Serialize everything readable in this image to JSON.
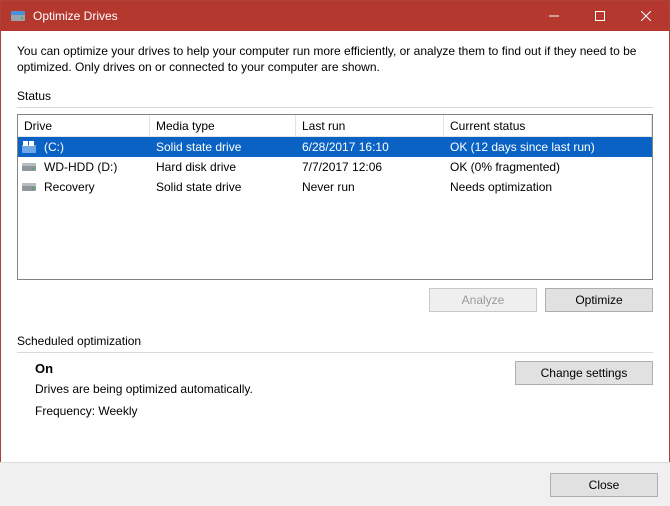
{
  "window": {
    "title": "Optimize Drives"
  },
  "intro": "You can optimize your drives to help your computer run more efficiently, or analyze them to find out if they need to be optimized. Only drives on or connected to your computer are shown.",
  "status_label": "Status",
  "headers": {
    "drive": "Drive",
    "media": "Media type",
    "last": "Last run",
    "status": "Current status"
  },
  "drives": [
    {
      "name": "(C:)",
      "icon": "windows",
      "media": "Solid state drive",
      "last": "6/28/2017 16:10",
      "status": "OK (12 days since last run)",
      "selected": true
    },
    {
      "name": "WD-HDD (D:)",
      "icon": "hdd",
      "media": "Hard disk drive",
      "last": "7/7/2017 12:06",
      "status": "OK (0% fragmented)",
      "selected": false
    },
    {
      "name": "Recovery",
      "icon": "hdd",
      "media": "Solid state drive",
      "last": "Never run",
      "status": "Needs optimization",
      "selected": false
    }
  ],
  "buttons": {
    "analyze": "Analyze",
    "optimize": "Optimize",
    "change_settings": "Change settings",
    "close": "Close"
  },
  "analyze_enabled": false,
  "scheduled": {
    "label": "Scheduled optimization",
    "status": "On",
    "line1": "Drives are being optimized automatically.",
    "line2": "Frequency: Weekly"
  }
}
